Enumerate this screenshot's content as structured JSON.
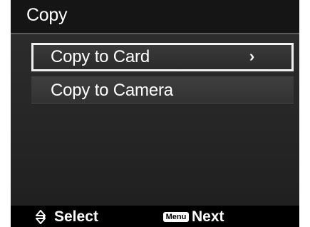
{
  "header": {
    "title": "Copy"
  },
  "menu": {
    "items": [
      {
        "label": "Copy to Card",
        "selected": true,
        "chevron": "›"
      },
      {
        "label": "Copy to Camera",
        "selected": false
      }
    ]
  },
  "footer": {
    "select_icon": "up-down-arrows-icon",
    "select_label": "Select",
    "menu_key_label": "Menu",
    "next_label": "Next"
  }
}
